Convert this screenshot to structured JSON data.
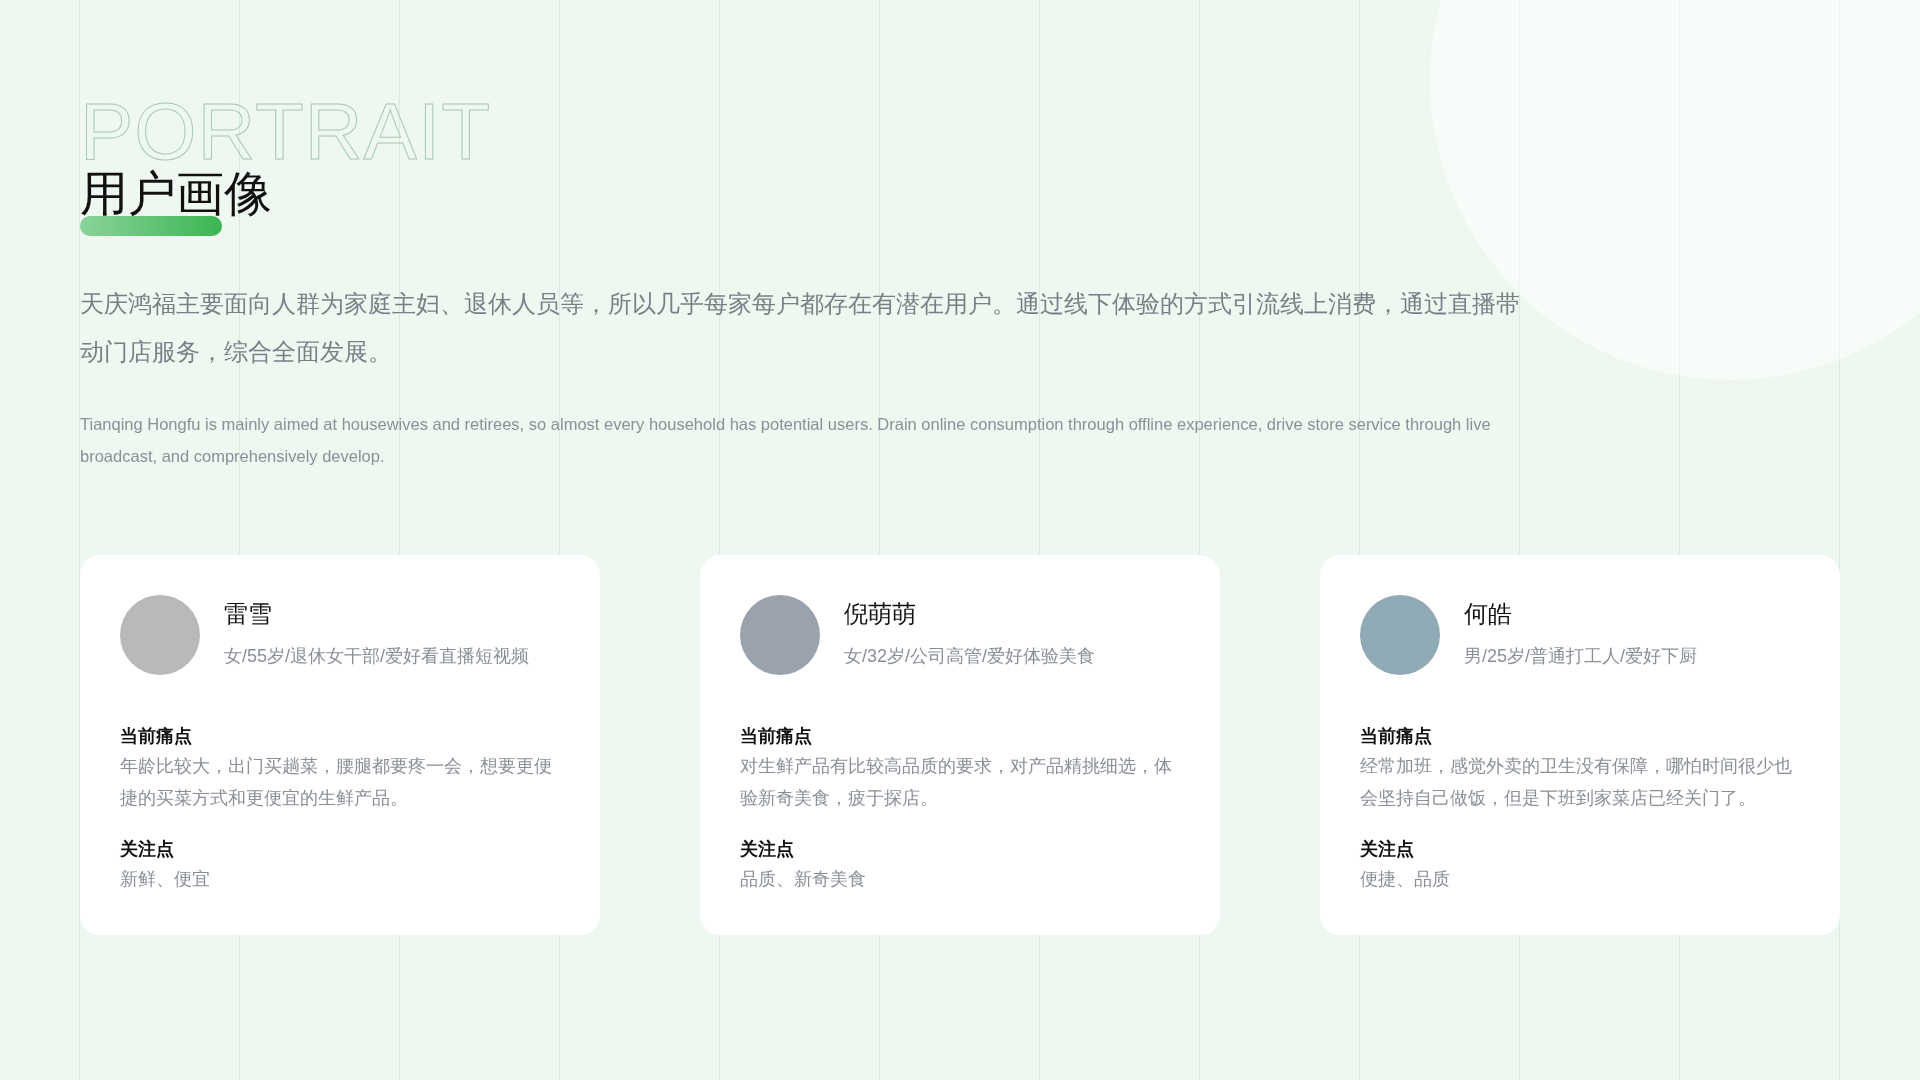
{
  "header": {
    "title": "用户画像",
    "title_en": "PORTRAIT",
    "intro_zh": "天庆鸿福主要面向人群为家庭主妇、退休人员等，所以几乎每家每户都存在有潜在用户。通过线下体验的方式引流线上消费，通过直播带动门店服务，综合全面发展。",
    "intro_en": "Tianqing Hongfu is mainly aimed at housewives and retirees, so almost every household has potential users. Drain online consumption through offline experience, drive store service through live broadcast, and comprehensively develop."
  },
  "personas": [
    {
      "name": "雷雪",
      "profile": "女/55岁/退休女干部/爱好看直播短视频",
      "pain_label": "当前痛点",
      "pain": "年龄比较大，出门买趟菜，腰腿都要疼一会，想要更便捷的买菜方式和更便宜的生鲜产品。",
      "focus_label": "关注点",
      "focus": "新鲜、便宜"
    },
    {
      "name": "倪萌萌",
      "profile": "女/32岁/公司高管/爱好体验美食",
      "pain_label": "当前痛点",
      "pain": "对生鲜产品有比较高品质的要求，对产品精挑细选，体验新奇美食，疲于探店。",
      "focus_label": "关注点",
      "focus": "品质、新奇美食"
    },
    {
      "name": "何皓",
      "profile": "男/25岁/普通打工人/爱好下厨",
      "pain_label": "当前痛点",
      "pain": "经常加班，感觉外卖的卫生没有保障，哪怕时间很少也会坚持自己做饭，但是下班到家菜店已经关门了。",
      "focus_label": "关注点",
      "focus": "便捷、品质"
    }
  ]
}
